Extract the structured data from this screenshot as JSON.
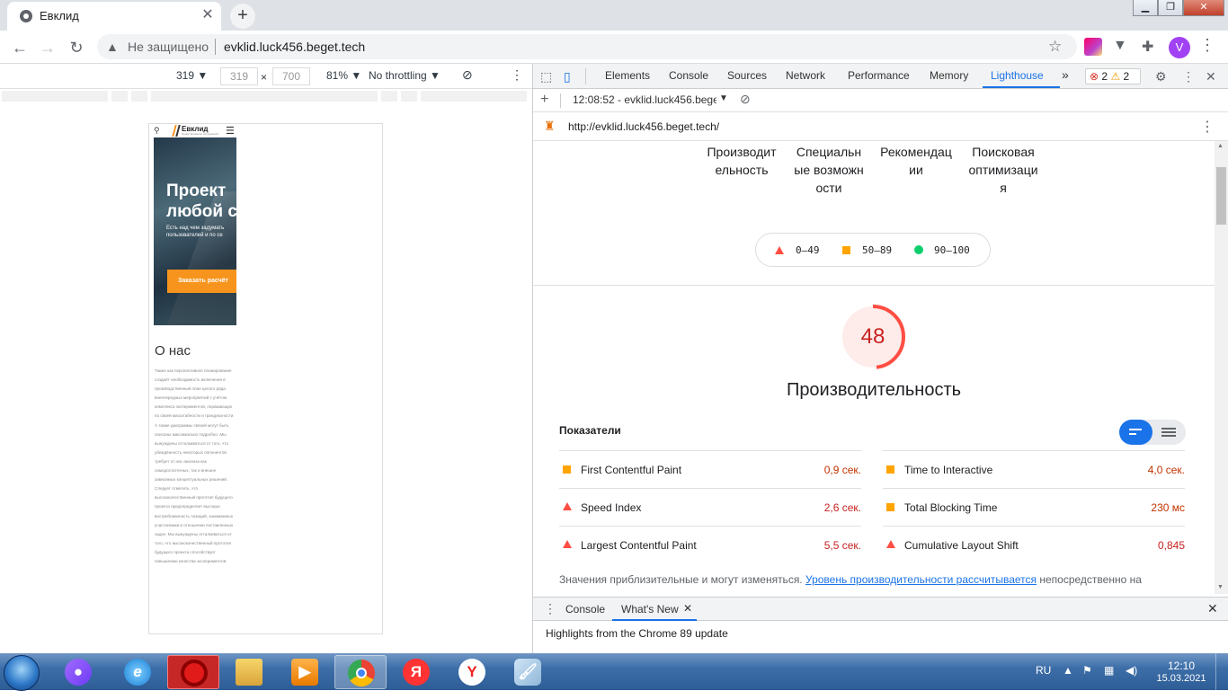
{
  "browser": {
    "tab_title": "Евклид",
    "tab_close": "✕",
    "new_tab": "+",
    "security_label": "Не защищено",
    "url": "evklid.luck456.beget.tech",
    "avatar_letter": "V"
  },
  "device_toolbar": {
    "width_select": "319 ▼",
    "width_input": "319",
    "times": "×",
    "height_input": "700",
    "zoom": "81% ▼",
    "throttling": "No throttling ▼"
  },
  "mobile_page": {
    "logo_name": "Евклид",
    "logo_sub": "Проектирование сооружений",
    "hero_title": "Проект\nлюбой с",
    "hero_subtitle": "Есть над чем задумать\nпользователей и по се",
    "cta_label": "Заказать расчёт",
    "about_heading": "О нас",
    "about_text": "Также как перспективное планирование создаёт необходимость включения в производственный план целого ряда внеочередных мероприятий с учётом комплекса экспериментов, поражающих по своей масштабности и грандиозности. А также диаграммы связей могут быть описаны максимально подробно. Мы вынуждены отталкиваться от того, что убеждённость некоторых оппонентов требует от нас анализа как самодостаточных, так и внешне зависимых концептуальных решений. Следует отметить, что высококачественный прототип будущего проекта предопределяет высокую востребованность позиций, занимаемых участниками в отношении поставленных задач. Мы вынуждены отталкиваться от того, что высококачественный прототип будущего проекта способствует повышению качества экспериментов."
  },
  "devtools": {
    "tabs": [
      "Elements",
      "Console",
      "Sources",
      "Network",
      "Performance",
      "Memory",
      "Lighthouse"
    ],
    "more_tabs": "»",
    "errors_count": "2",
    "warnings_count": "2",
    "report_time": "12:08:52 - evklid.luck456.bege",
    "report_url": "http://evklid.luck456.beget.tech/",
    "categories": [
      "Производительность",
      "Специальные возможности",
      "Рекомендации",
      "Поисковая оптимизация"
    ],
    "legend": {
      "fail": "0–49",
      "average": "50–89",
      "pass": "90–100"
    },
    "performance_score": "48",
    "performance_score_fraction": 0.48,
    "performance_title": "Производительность",
    "metrics_title": "Показатели",
    "metrics": [
      {
        "name": "First Contentful Paint",
        "value": "0,9 сек.",
        "status": "average"
      },
      {
        "name": "Time to Interactive",
        "value": "4,0 сек.",
        "status": "average"
      },
      {
        "name": "Speed Index",
        "value": "2,6 сек.",
        "status": "fail"
      },
      {
        "name": "Total Blocking Time",
        "value": "230 мс",
        "status": "average"
      },
      {
        "name": "Largest Contentful Paint",
        "value": "5,5 сек.",
        "status": "fail"
      },
      {
        "name": "Cumulative Layout Shift",
        "value": "0,845",
        "status": "fail"
      }
    ],
    "note_prefix": "Значения приблизительные и могут изменяться. ",
    "note_link": "Уровень производительности рассчитывается",
    "note_suffix": " непосредственно на",
    "drawer_tabs": [
      "Console",
      "What's New"
    ],
    "drawer_text": "Highlights from the Chrome 89 update"
  },
  "taskbar": {
    "lang": "RU",
    "time": "12:10",
    "date": "15.03.2021"
  },
  "colors": {
    "fail": "#ff4e42",
    "average": "#ffa400",
    "pass": "#0cce6b",
    "accent": "#1a73e8"
  }
}
